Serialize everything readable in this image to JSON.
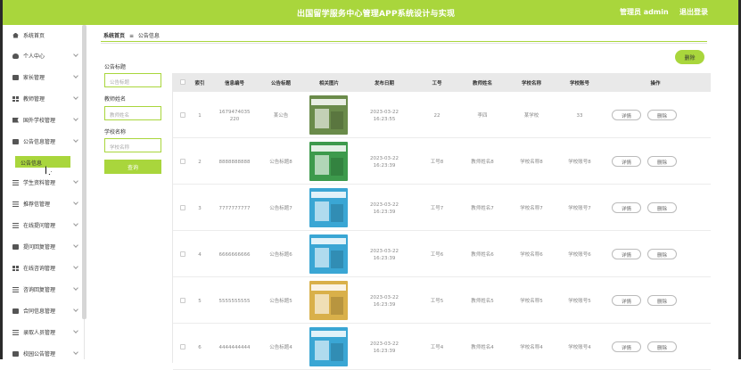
{
  "header": {
    "title": "出国留学服务中心管理APP系统设计与实现",
    "admin": "管理员 admin",
    "logout": "退出登录"
  },
  "sidebar": {
    "items": [
      {
        "label": "系统首页",
        "icon": "home-icon"
      },
      {
        "label": "个人中心",
        "icon": "user-icon"
      },
      {
        "label": "家长管理",
        "icon": "briefcase-icon"
      },
      {
        "label": "教师管理",
        "icon": "grid-icon"
      },
      {
        "label": "国外学校管理",
        "icon": "flag-icon"
      },
      {
        "label": "公告信息管理",
        "icon": "monitor-icon"
      },
      {
        "label": "学生资料管理",
        "icon": "list-icon"
      },
      {
        "label": "推荐信管理",
        "icon": "list-icon"
      },
      {
        "label": "在线提问管理",
        "icon": "list-icon"
      },
      {
        "label": "提问回复管理",
        "icon": "doc-icon"
      },
      {
        "label": "在线咨询管理",
        "icon": "grid-icon"
      },
      {
        "label": "咨询回复管理",
        "icon": "list-icon"
      },
      {
        "label": "合同信息管理",
        "icon": "doc-icon"
      },
      {
        "label": "录取人员管理",
        "icon": "list-icon"
      },
      {
        "label": "校园公告管理",
        "icon": "doc-icon"
      }
    ],
    "active_sub": "公告信息"
  },
  "breadcrumb": {
    "home": "系统首页",
    "sep": "≡",
    "current": "公告信息"
  },
  "filters": {
    "title_label": "公告标题",
    "title_placeholder": "公告标题",
    "teacher_label": "教师姓名",
    "teacher_placeholder": "教师姓名",
    "school_label": "学校名称",
    "school_placeholder": "学校名称",
    "search_label": "查询"
  },
  "delete_top": "删除",
  "table": {
    "headers": [
      "索引",
      "信息编号",
      "公告标题",
      "相关图片",
      "发布日期",
      "工号",
      "教师姓名",
      "学校名称",
      "学校账号",
      "操作"
    ],
    "rows": [
      {
        "idx": "1",
        "code": "1679474035220",
        "title": "某公告",
        "date": "2023-03-22 16:23:55",
        "work": "22",
        "teacher": "李四",
        "school": "某学校",
        "account": "33",
        "img": "#6a8b4a",
        "detail": "详情",
        "del": "删除"
      },
      {
        "idx": "2",
        "code": "8888888888",
        "title": "公告标题8",
        "date": "2023-03-22 16:23:39",
        "work": "工号8",
        "teacher": "教师姓名8",
        "school": "学校名称8",
        "account": "学校账号8",
        "img": "#3d9a4c",
        "detail": "详情",
        "del": "删除"
      },
      {
        "idx": "3",
        "code": "7777777777",
        "title": "公告标题7",
        "date": "2023-03-22 16:23:39",
        "work": "工号7",
        "teacher": "教师姓名7",
        "school": "学校名称7",
        "account": "学校账号7",
        "img": "#3aa6d4",
        "detail": "详情",
        "del": "删除"
      },
      {
        "idx": "4",
        "code": "6666666666",
        "title": "公告标题6",
        "date": "2023-03-22 16:23:39",
        "work": "工号6",
        "teacher": "教师姓名6",
        "school": "学校名称6",
        "account": "学校账号6",
        "img": "#3aa6d4",
        "detail": "详情",
        "del": "删除"
      },
      {
        "idx": "5",
        "code": "5555555555",
        "title": "公告标题5",
        "date": "2023-03-22 16:23:39",
        "work": "工号5",
        "teacher": "教师姓名5",
        "school": "学校名称5",
        "account": "学校账号5",
        "img": "#d9b04a",
        "detail": "详情",
        "del": "删除"
      },
      {
        "idx": "6",
        "code": "4444444444",
        "title": "公告标题4",
        "date": "2023-03-22 16:23:39",
        "work": "工号4",
        "teacher": "教师姓名4",
        "school": "学校名称4",
        "account": "学校账号4",
        "img": "#3aa6d4",
        "detail": "详情",
        "del": "删除"
      }
    ]
  },
  "colors": {
    "accent": "#a9d63c"
  }
}
